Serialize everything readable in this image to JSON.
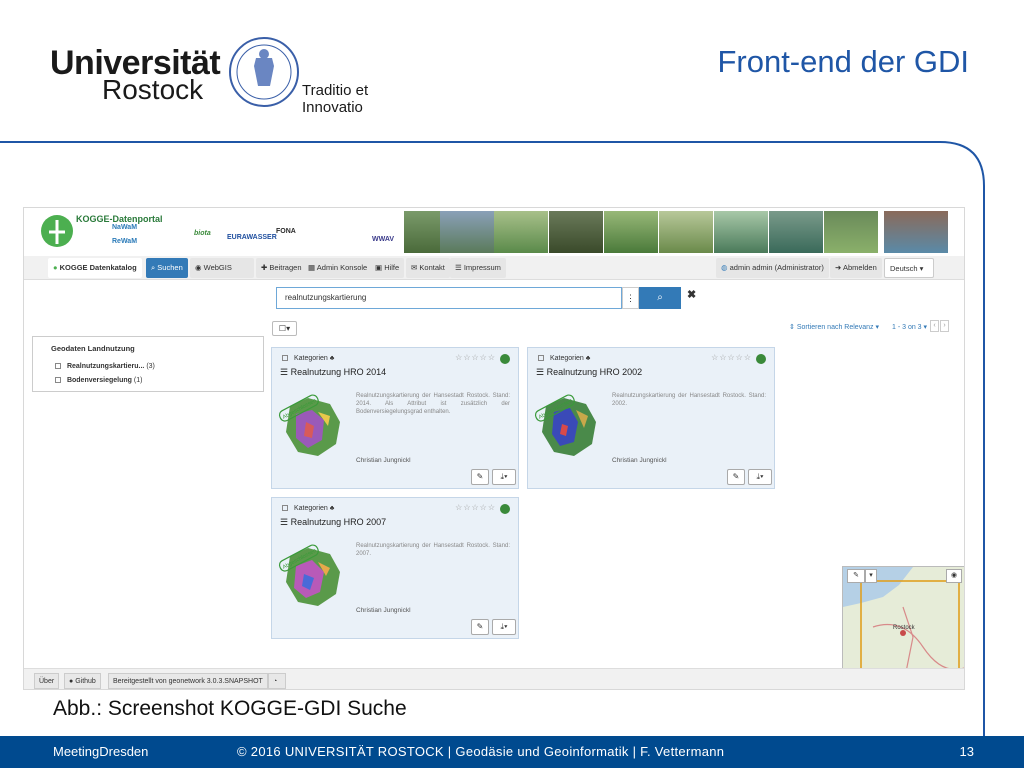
{
  "slide": {
    "university_name": "Universität",
    "university_city": "Rostock",
    "motto": "Traditio et Innovatio",
    "title": "Front-end der GDI",
    "caption": "Abb.: Screenshot KOGGE-GDI Suche"
  },
  "footer_bar": {
    "left": "MeetingDresden",
    "middle": "© 2016 UNIVERSITÄT ROSTOCK | Geodäsie und Geoinformatik | F. Vettermann",
    "page_number": "13"
  },
  "app": {
    "portal_title": "KOGGE-Datenportal",
    "partners": [
      "NaWaM",
      "ReWaM",
      "biota",
      "EURAWASSER",
      "FONA",
      "WWAV"
    ],
    "nav": {
      "brand": "KOGGE Datenkatalog",
      "suchen": "Suchen",
      "webgis": "WebGIS",
      "beitragen": "Beitragen",
      "admin_konsole": "Admin Konsole",
      "hilfe": "Hilfe",
      "kontakt": "Kontakt",
      "impressum": "Impressum",
      "user": "admin admin (Administrator)",
      "abmelden": "Abmelden",
      "language": "Deutsch"
    },
    "search": {
      "value": "realnutzungskartierung"
    },
    "facets": {
      "title": "Geodaten Landnutzung",
      "items": [
        {
          "label": "Realnutzungskartieru...",
          "count": "(3)"
        },
        {
          "label": "Bodenversiegelung",
          "count": "(1)"
        }
      ]
    },
    "results_toolbar": {
      "sort": "Sortieren nach Relevanz",
      "paging": "1 - 3 on 3"
    },
    "cards": [
      {
        "category": "Kategorien",
        "title": "Realnutzung HRO 2014",
        "description": "Realnutzungskartierung der Hansestadt Rostock. Stand: 2014. Als Attribut ist zusätzlich der Bodenversiegelungsgrad enthalten.",
        "author": "Christian Jungnickl",
        "stamp": "Abgeschlossen"
      },
      {
        "category": "Kategorien",
        "title": "Realnutzung HRO 2002",
        "description": "Realnutzungskartierung der Hansestadt Rostock. Stand: 2002.",
        "author": "Christian Jungnickl",
        "stamp": "Abgeschlossen"
      },
      {
        "category": "Kategorien",
        "title": "Realnutzung HRO 2007",
        "description": "Realnutzungskartierung der Hansestadt Rostock. Stand: 2007.",
        "author": "Christian Jungnickl",
        "stamp": "Abgeschlossen"
      }
    ],
    "map": {
      "city_label": "Rostock"
    },
    "footer": {
      "ueber": "Über",
      "github": "Github",
      "provided_by": "Bereitgestellt von geonetwork 3.0.3.SNAPSHOT"
    }
  },
  "colors": {
    "accent": "#337ab7",
    "title_blue": "#1f56a6",
    "bottom_bar": "#004a8f",
    "card_bg": "#eaf1f8"
  }
}
